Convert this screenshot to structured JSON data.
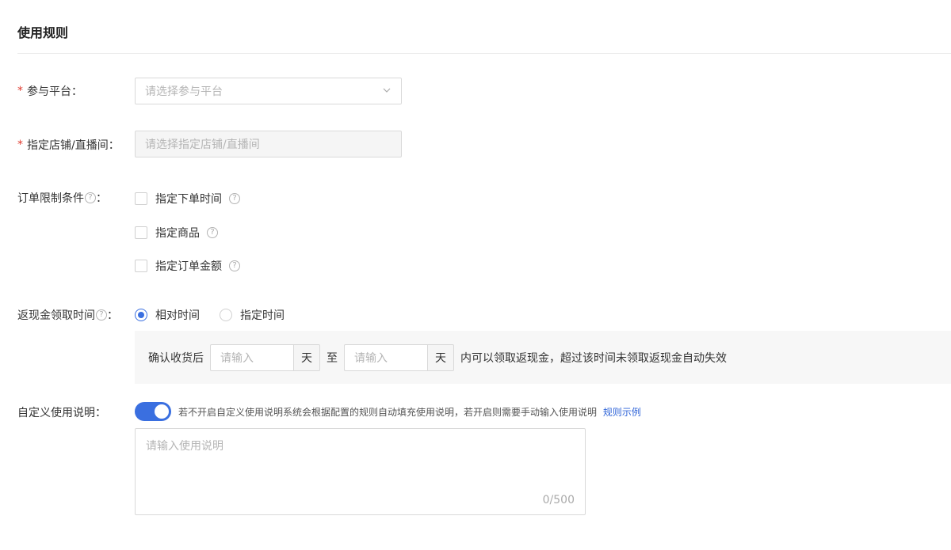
{
  "section": {
    "title": "使用规则"
  },
  "platform": {
    "label": "参与平台：",
    "required": "*",
    "placeholder": "请选择参与平台"
  },
  "store": {
    "label": "指定店铺/直播间：",
    "required": "*",
    "placeholder": "请选择指定店铺/直播间"
  },
  "order_conditions": {
    "label": "订单限制条件",
    "colon": "：",
    "options": [
      {
        "label": "指定下单时间",
        "checked": false
      },
      {
        "label": "指定商品",
        "checked": false
      },
      {
        "label": "指定订单金额",
        "checked": false
      }
    ]
  },
  "cashback_time": {
    "label": "返现金领取时间",
    "colon": "：",
    "options": [
      {
        "label": "相对时间",
        "selected": true
      },
      {
        "label": "指定时间",
        "selected": false
      }
    ],
    "panel": {
      "prefix": "确认收货后",
      "from_placeholder": "请输入",
      "unit1": "天",
      "to": "至",
      "to_placeholder": "请输入",
      "unit2": "天",
      "suffix": "内可以领取返现金，超过该时间未领取返现金自动失效"
    }
  },
  "custom_desc": {
    "label": "自定义使用说明：",
    "toggle_on": true,
    "hint": "若不开启自定义使用说明系统会根据配置的规则自动填充使用说明，若开启则需要手动输入使用说明",
    "link": "规则示例",
    "placeholder": "请输入使用说明",
    "counter": "0/500"
  },
  "icons": {
    "help": "?"
  },
  "colors": {
    "primary": "#3a6fe0",
    "required": "#e03a2e",
    "link": "#2f64d8"
  }
}
